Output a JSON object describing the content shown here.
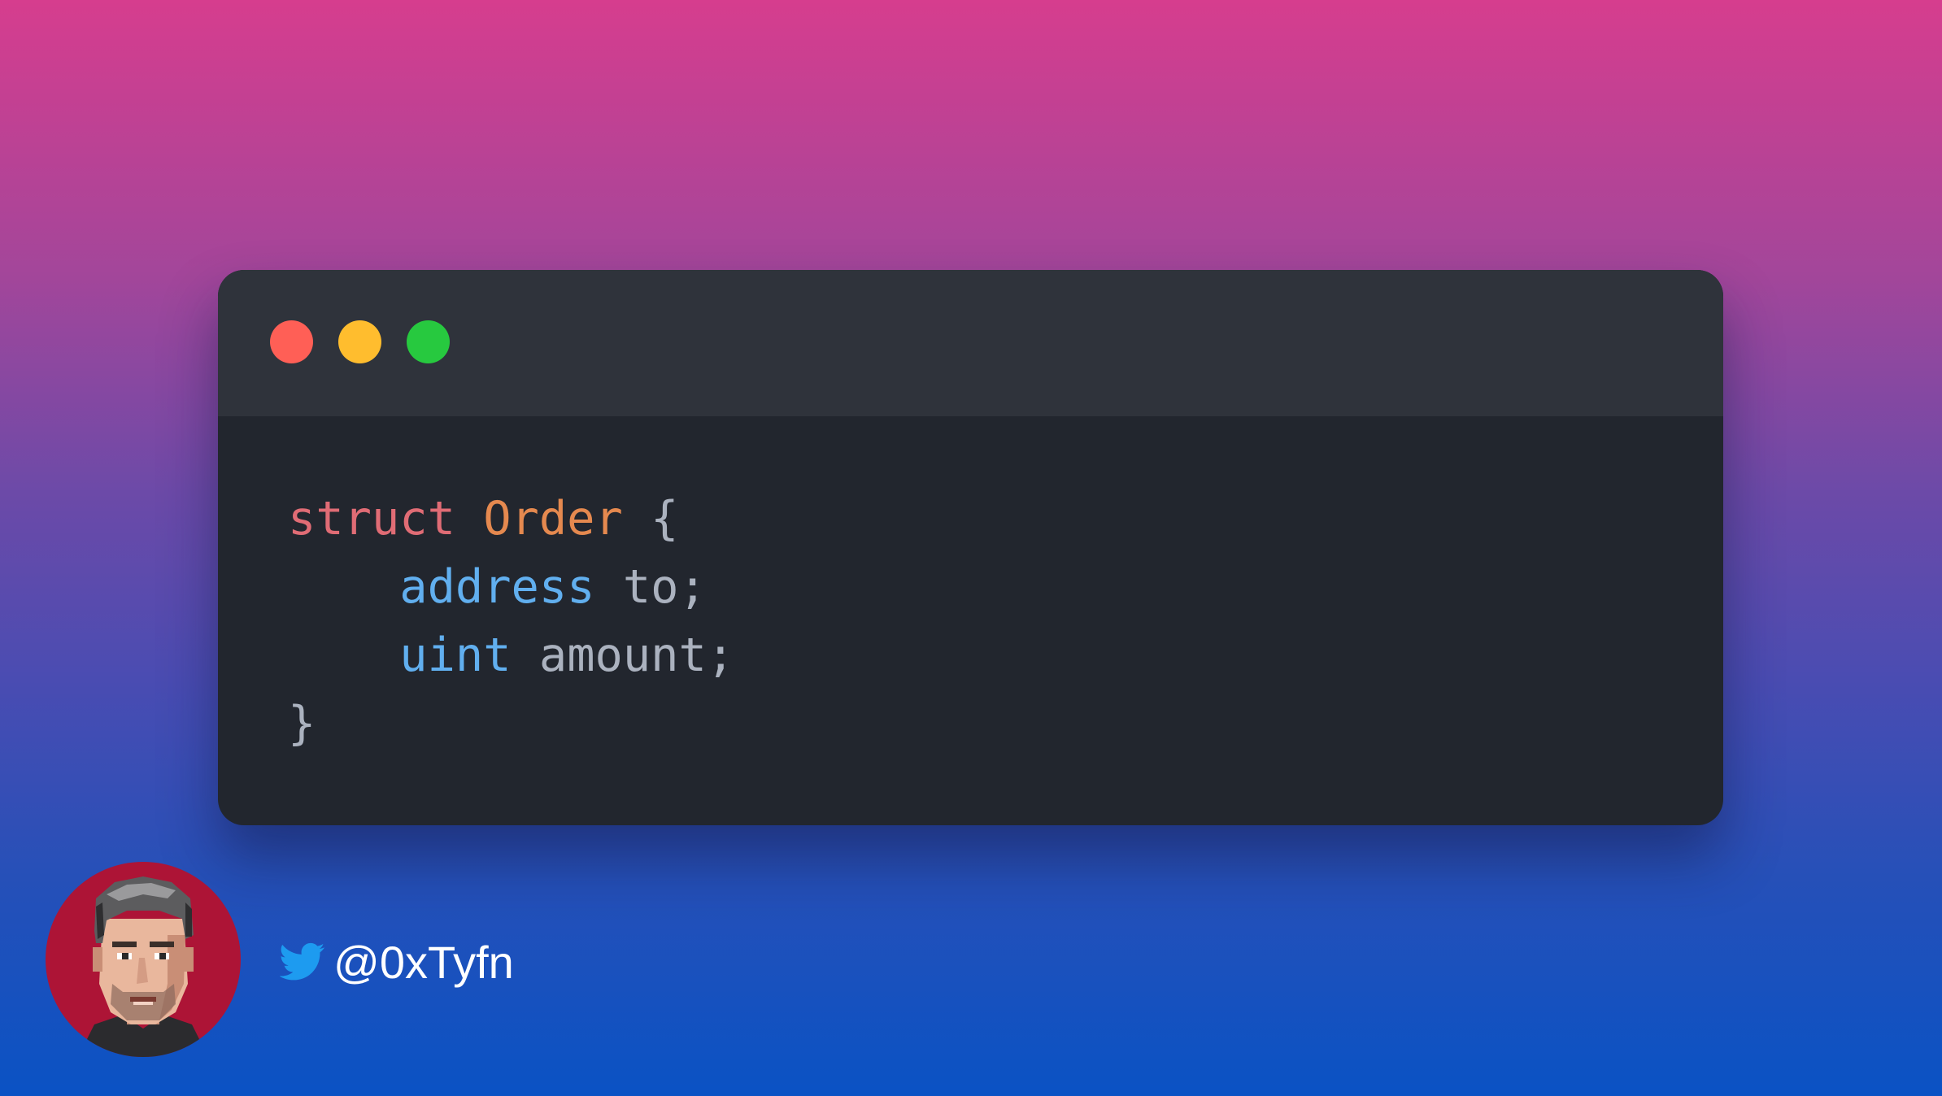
{
  "code_window": {
    "controls": [
      "close",
      "minimize",
      "maximize"
    ],
    "lines": [
      {
        "indent": "",
        "tokens": [
          {
            "text": "struct",
            "kind": "keyword"
          },
          {
            "text": " ",
            "kind": "plain"
          },
          {
            "text": "Order",
            "kind": "type"
          },
          {
            "text": " {",
            "kind": "plain"
          }
        ]
      },
      {
        "indent": "    ",
        "tokens": [
          {
            "text": "address",
            "kind": "decl"
          },
          {
            "text": " to;",
            "kind": "plain"
          }
        ]
      },
      {
        "indent": "    ",
        "tokens": [
          {
            "text": "uint",
            "kind": "decl"
          },
          {
            "text": " amount;",
            "kind": "plain"
          }
        ]
      },
      {
        "indent": "",
        "tokens": [
          {
            "text": "}",
            "kind": "plain"
          }
        ]
      }
    ],
    "colors": {
      "keyword": "#e06c75",
      "type": "#e5894f",
      "decl": "#61afef",
      "plain": "#abb2bf",
      "window_bg": "#22262e",
      "titlebar_bg": "#2f333b",
      "close": "#ff5f56",
      "minimize": "#ffbd2e",
      "maximize": "#27c93f"
    }
  },
  "author": {
    "icon": "twitter-bird-icon",
    "handle": "@0xTyfn",
    "avatar_bg": "#ad1436",
    "brand_color": "#1d9bf0"
  }
}
